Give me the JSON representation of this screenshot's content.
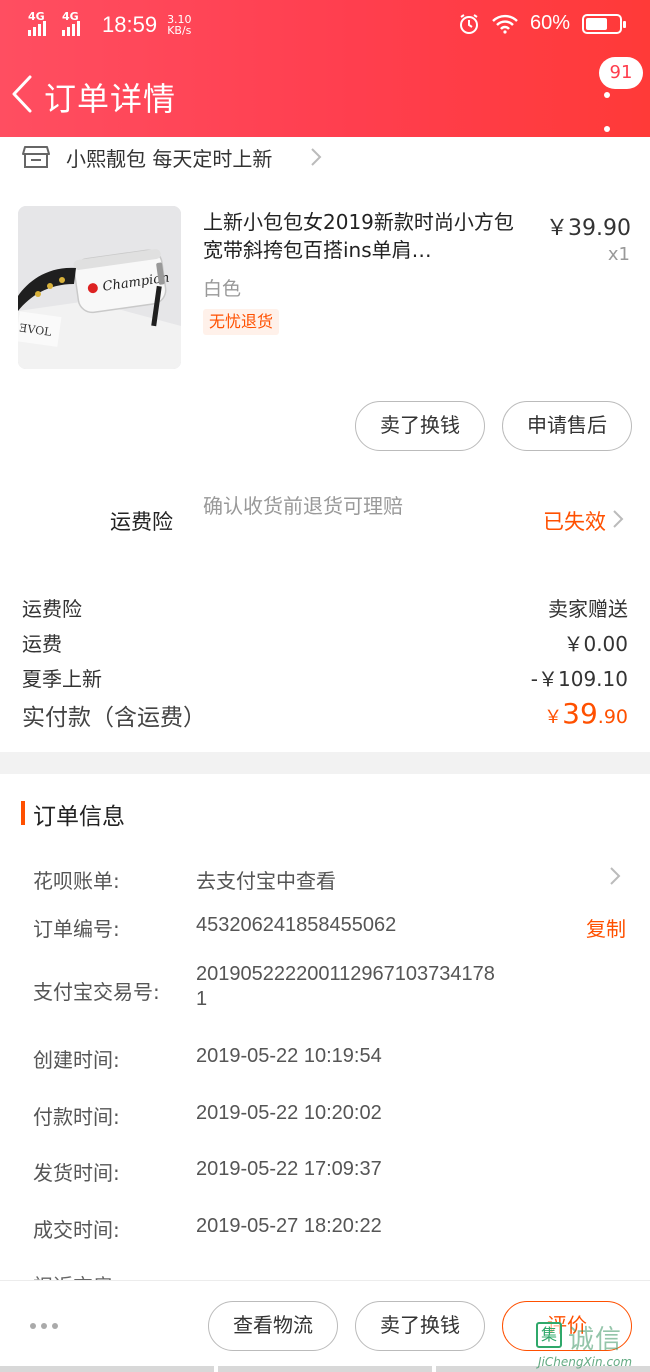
{
  "status_bar": {
    "network_1": "4G",
    "network_2": "4G",
    "time": "18:59",
    "speed_value": "3.10",
    "speed_unit": "KB/s",
    "battery": "60%"
  },
  "nav": {
    "title": "订单详情",
    "badge_count": "91"
  },
  "shop": {
    "name": "小熙靓包 每天定时上新"
  },
  "product": {
    "title": "上新小包包女2019新款时尚小方包宽带斜挎包百搭ins单肩…",
    "price": "￥39.90",
    "quantity": "x1",
    "sku": "白色",
    "tag": "无忧退货",
    "image_logo_text": "Champion"
  },
  "item_actions": {
    "sell_exchange": "卖了换钱",
    "after_sale": "申请售后"
  },
  "shipping_insurance": {
    "label": "运费险",
    "description": "确认收货前退货可理赔",
    "status": "已失效"
  },
  "summary": {
    "rows": [
      {
        "label": "运费险",
        "value": "卖家赠送"
      },
      {
        "label": "运费",
        "value": "￥0.00"
      },
      {
        "label": "夏季上新",
        "value": "-￥109.10"
      }
    ],
    "total_label": "实付款（含运费）",
    "total_currency": "￥",
    "total_int": "39",
    "total_dec": ".90"
  },
  "order_info": {
    "title": "订单信息",
    "huabei_label": "花呗账单:",
    "huabei_value": "去支付宝中查看",
    "order_no_label": "订单编号:",
    "order_no_value": "453206241858455062",
    "copy_label": "复制",
    "alipay_label": "支付宝交易号:",
    "alipay_value_line1": "201905222200112967103734178",
    "alipay_value_line2": "1",
    "created_label": "创建时间:",
    "created_value": "2019-05-22 10:19:54",
    "paid_label": "付款时间:",
    "paid_value": "2019-05-22 10:20:02",
    "shipped_label": "发货时间:",
    "shipped_value": "2019-05-22 17:09:37",
    "deal_label": "成交时间:",
    "deal_value": "2019-05-27 18:20:22",
    "partial_label": "祝近交房"
  },
  "bottom_bar": {
    "logistics": "查看物流",
    "sell_exchange": "卖了换钱",
    "review": "评价"
  },
  "watermark": {
    "box_char": "集",
    "text": "诚信",
    "url": "JiChengXin.com"
  },
  "colors": {
    "header_start": "#ff4e61",
    "header_end": "#ff3a38",
    "accent_orange": "#ff5000"
  }
}
